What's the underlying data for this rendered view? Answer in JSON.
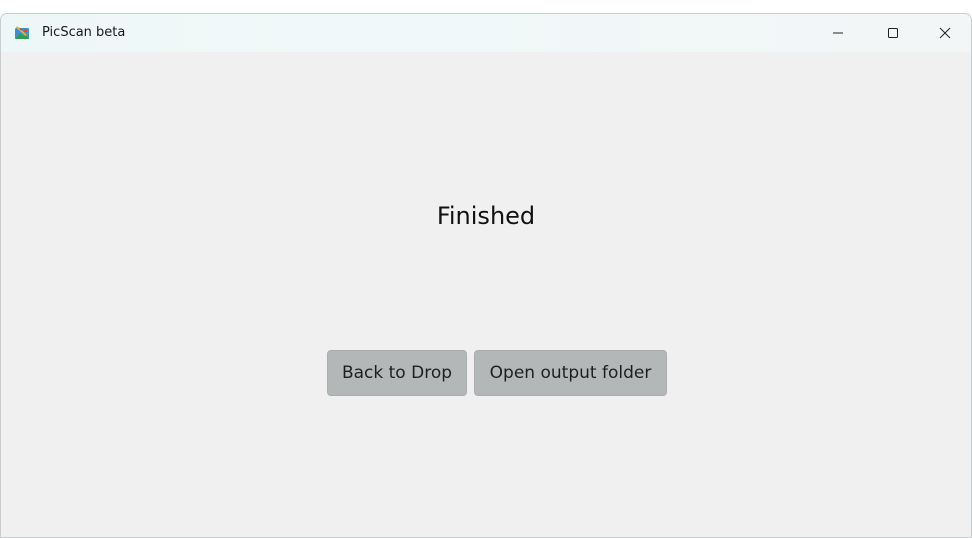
{
  "window": {
    "title": "PicScan beta",
    "controls": {
      "minimize": "minimize-icon",
      "maximize": "maximize-icon",
      "close": "close-icon"
    }
  },
  "main": {
    "status": "Finished",
    "buttons": {
      "back": "Back to Drop",
      "open_folder": "Open output folder"
    }
  },
  "colors": {
    "background": "#f0f0f0",
    "button_bg": "#b3b7b8"
  }
}
